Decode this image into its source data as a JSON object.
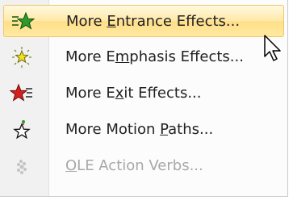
{
  "menu": {
    "items": [
      {
        "pre": "More ",
        "key": "E",
        "post": "ntrance Effects...",
        "icon": "entrance-star-icon",
        "state": "hover"
      },
      {
        "pre": "More E",
        "key": "m",
        "post": "phasis Effects...",
        "icon": "emphasis-star-icon",
        "state": "normal"
      },
      {
        "pre": "More E",
        "key": "x",
        "post": "it Effects...",
        "icon": "exit-star-icon",
        "state": "normal"
      },
      {
        "pre": "More Motion ",
        "key": "P",
        "post": "aths...",
        "icon": "motion-path-star-icon",
        "state": "normal"
      },
      {
        "pre": "",
        "key": "O",
        "post": "LE Action Verbs...",
        "icon": "ole-action-icon",
        "state": "disabled"
      }
    ]
  },
  "colors": {
    "entrance_star": "#2e9a2e",
    "emphasis_star": "#f4e21a",
    "exit_star": "#d41f1f",
    "hover_border": "#f2c66a"
  }
}
